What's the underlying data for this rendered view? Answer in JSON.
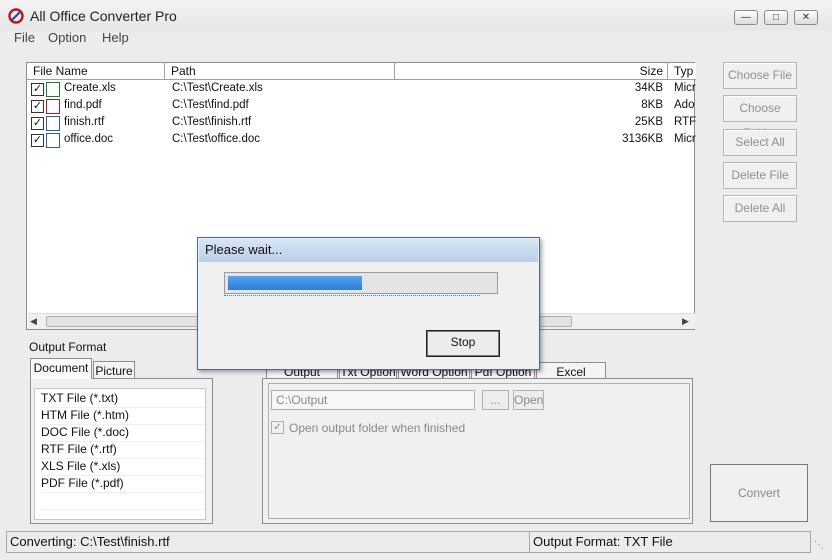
{
  "window": {
    "title": "All Office Converter Pro"
  },
  "menu": [
    "File",
    "Option",
    "Help"
  ],
  "filelist": {
    "headers": {
      "name": "File Name",
      "path": "Path",
      "size": "Size",
      "type": "Typ"
    },
    "rows": [
      {
        "name": "Create.xls",
        "path": "C:\\Test\\Create.xls",
        "size": "34KB",
        "type": "Micr",
        "icon": "xls-file-icon",
        "checked": true
      },
      {
        "name": "find.pdf",
        "path": "C:\\Test\\find.pdf",
        "size": "8KB",
        "type": "Ado",
        "icon": "pdf-file-icon",
        "checked": true
      },
      {
        "name": "finish.rtf",
        "path": "C:\\Test\\finish.rtf",
        "size": "25KB",
        "type": "RTF",
        "icon": "rtf-file-icon",
        "checked": true
      },
      {
        "name": "office.doc",
        "path": "C:\\Test\\office.doc",
        "size": "3136KB",
        "type": "Micr",
        "icon": "doc-file-icon",
        "checked": true
      }
    ]
  },
  "side_buttons": {
    "choose_file": "Choose File",
    "choose_folder": "Choose Folder",
    "select_all": "Select All",
    "delete_file": "Delete File",
    "delete_all": "Delete All"
  },
  "output_format": {
    "label": "Output Format",
    "tabs": {
      "document": "Document",
      "picture": "Picture"
    },
    "formats": [
      "TXT File  (*.txt)",
      "HTM File  (*.htm)",
      "DOC File  (*.doc)",
      "RTF File  (*.rtf)",
      "XLS File  (*.xls)",
      "PDF File  (*.pdf)"
    ]
  },
  "options": {
    "tabs": [
      "Output Folder",
      "Txt Option",
      "Word Option",
      "Pdf Option",
      "Excel Option"
    ],
    "folder_value": "C:\\Output",
    "browse_label": "...",
    "open_label": "Open",
    "open_when_finished_label": "Open output folder when finished",
    "open_when_finished": true
  },
  "convert_label": "Convert",
  "status": {
    "converting": "Converting:  C:\\Test\\finish.rtf",
    "format": "Output Format: TXT File"
  },
  "dialog": {
    "title": "Please wait...",
    "stop_label": "Stop",
    "progress": 0.5
  },
  "colors": {
    "progress": "#2c7fd8",
    "titlebar": "#e6e6e6"
  }
}
